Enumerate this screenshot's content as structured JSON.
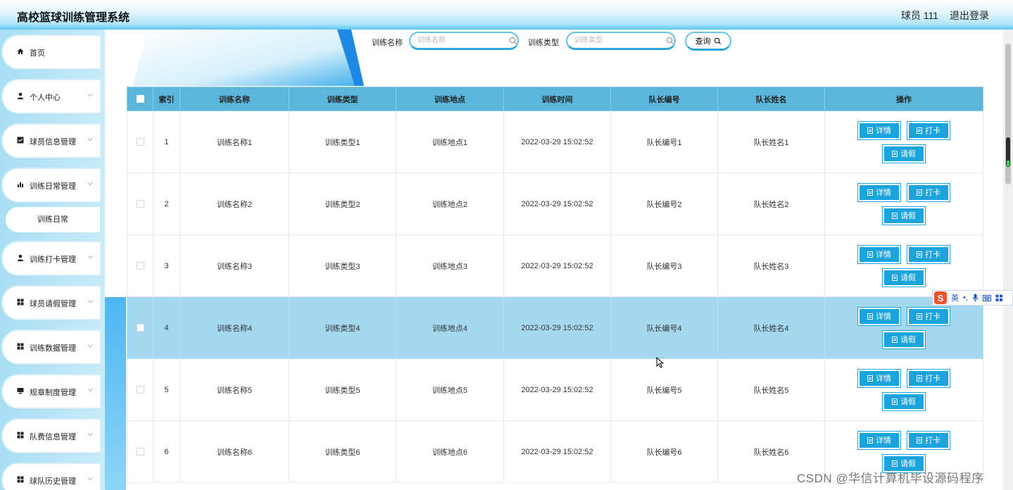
{
  "header": {
    "title": "高校篮球训练管理系统",
    "user": "球员 111",
    "logout": "退出登录"
  },
  "sidebar": {
    "items": [
      {
        "label": "首页",
        "icon": "home-icon",
        "has_chevron": false
      },
      {
        "label": "个人中心",
        "icon": "user-icon",
        "has_chevron": true
      },
      {
        "label": "球员信息管理",
        "icon": "chart-square-icon",
        "has_chevron": true
      },
      {
        "label": "训练日常管理",
        "icon": "bar-chart-icon",
        "has_chevron": true
      },
      {
        "label": "训练打卡管理",
        "icon": "user-icon",
        "has_chevron": true
      },
      {
        "label": "球员请假管理",
        "icon": "grid-icon",
        "has_chevron": true
      },
      {
        "label": "训练数据管理",
        "icon": "grid-icon",
        "has_chevron": true
      },
      {
        "label": "规章制度管理",
        "icon": "monitor-icon",
        "has_chevron": true
      },
      {
        "label": "队费信息管理",
        "icon": "grid-icon",
        "has_chevron": true
      },
      {
        "label": "球队历史管理",
        "icon": "grid-icon",
        "has_chevron": true
      }
    ],
    "submenu_label": "训练日常"
  },
  "search": {
    "name_label": "训练名称",
    "name_placeholder": "训练名称",
    "type_label": "训练类型",
    "type_placeholder": "训练类型",
    "query_label": "查询"
  },
  "table": {
    "headers": [
      "",
      "索引",
      "训练名称",
      "训练类型",
      "训练地点",
      "训练时间",
      "队长编号",
      "队长姓名",
      "操作"
    ],
    "rows": [
      {
        "index": "1",
        "name": "训练名称1",
        "type": "训练类型1",
        "place": "训练地点1",
        "time": "2022-03-29 15:02:52",
        "captain_no": "队长编号1",
        "captain_name": "队长姓名1"
      },
      {
        "index": "2",
        "name": "训练名称2",
        "type": "训练类型2",
        "place": "训练地点2",
        "time": "2022-03-29 15:02:52",
        "captain_no": "队长编号2",
        "captain_name": "队长姓名2"
      },
      {
        "index": "3",
        "name": "训练名称3",
        "type": "训练类型3",
        "place": "训练地点3",
        "time": "2022-03-29 15:02:52",
        "captain_no": "队长编号3",
        "captain_name": "队长姓名3"
      },
      {
        "index": "4",
        "name": "训练名称4",
        "type": "训练类型4",
        "place": "训练地点4",
        "time": "2022-03-29 15:02:52",
        "captain_no": "队长编号4",
        "captain_name": "队长姓名4"
      },
      {
        "index": "5",
        "name": "训练名称5",
        "type": "训练类型5",
        "place": "训练地点5",
        "time": "2022-03-29 15:02:52",
        "captain_no": "队长编号5",
        "captain_name": "队长姓名5"
      },
      {
        "index": "6",
        "name": "训练名称6",
        "type": "训练类型6",
        "place": "训练地点6",
        "time": "2022-03-29 15:02:52",
        "captain_no": "队长编号6",
        "captain_name": "队长姓名6"
      }
    ],
    "highlighted_row": "4",
    "actions": {
      "detail": "详情",
      "checkin": "打卡",
      "leave": "请假"
    }
  },
  "ime": {
    "mode": "英"
  },
  "watermark": "CSDN @华信计算机毕设源码程序",
  "colors": {
    "accent": "#1aa3dc",
    "header_row": "#5cb6dc",
    "highlight_row": "#a5d8ee"
  }
}
